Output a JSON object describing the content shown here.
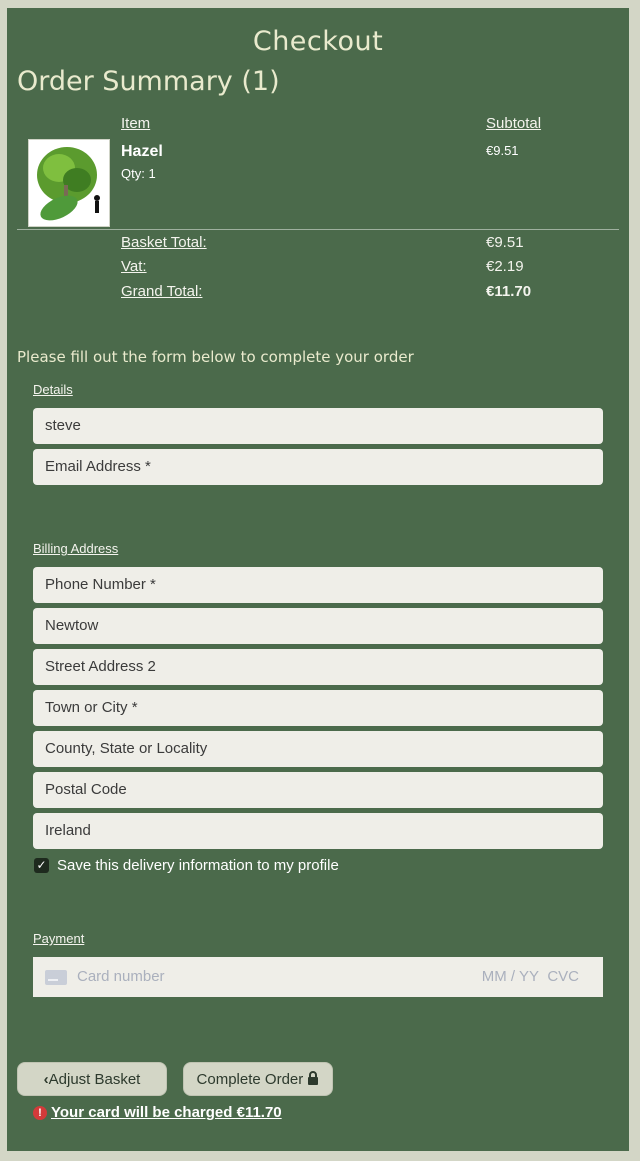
{
  "header": {
    "title": "Checkout"
  },
  "summary": {
    "title": "Order Summary (1)",
    "col_item": "Item",
    "col_subtotal": "Subtotal",
    "item": {
      "name": "Hazel",
      "qty": "Qty: 1",
      "subtotal": "€9.51"
    },
    "basket_total_label": "Basket Total:",
    "basket_total": "€9.51",
    "vat_label": "Vat:",
    "vat": "€2.19",
    "grand_total_label": "Grand Total:",
    "grand_total": "€11.70"
  },
  "form": {
    "instructions": "Please fill out the form below to complete your order",
    "details_label": "Details",
    "full_name": "steve",
    "email_placeholder": "Email Address *",
    "billing_label": "Billing Address",
    "phone_placeholder": "Phone Number *",
    "street1": "Newtow",
    "street2_placeholder": "Street Address 2",
    "town_placeholder": "Town or City *",
    "county_placeholder": "County, State or Locality",
    "postal_placeholder": "Postal Code",
    "country": "Ireland",
    "save_info_label": "Save this delivery information to my profile",
    "payment_label": "Payment",
    "card_placeholder": "Card number",
    "card_expiry": "MM / YY",
    "card_cvc": "CVC"
  },
  "actions": {
    "adjust_basket": "Adjust Basket",
    "complete_order": "Complete Order",
    "charge_warning": "Your card will be charged €11.70"
  },
  "colors": {
    "panel": "#4b6a4b",
    "page": "#d3d6c6",
    "heading": "#e9eacd",
    "field": "#efeee8"
  }
}
